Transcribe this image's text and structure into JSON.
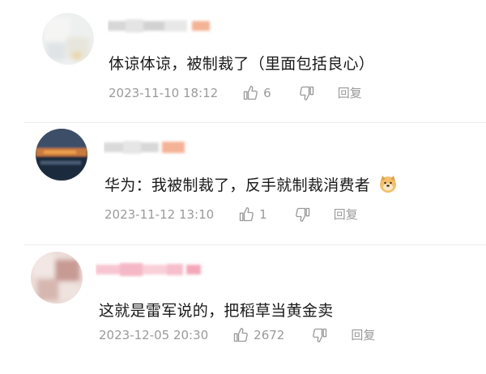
{
  "comments": [
    {
      "text": "体谅体谅，被制裁了（里面包括良心）",
      "time": "2023-11-10 18:12",
      "likes": "6",
      "reply_label": "回复"
    },
    {
      "text": "华为：我被制裁了，反手就制裁消费者",
      "time": "2023-11-12 13:10",
      "likes": "1",
      "reply_label": "回复",
      "emoji_icon": "doge-icon"
    },
    {
      "text": "这就是雷军说的，把稻草当黄金卖",
      "time": "2023-12-05 20:30",
      "likes": "2672",
      "reply_label": "回复"
    }
  ],
  "colors": {
    "text": "#1a1a1a",
    "meta": "#9a9a9a",
    "name_blur_gray": "#d9d9d9",
    "name_blur_orange": "#f4b296",
    "name_blur_pink": "#f7c3cf"
  }
}
